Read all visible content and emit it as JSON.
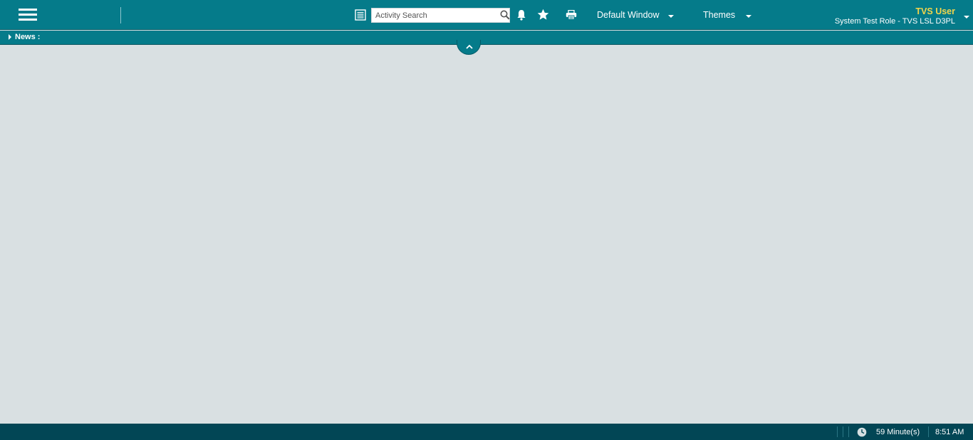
{
  "header": {
    "search_placeholder": "Activity Search",
    "default_window_label": "Default Window",
    "themes_label": "Themes",
    "user_name": "TVS User",
    "user_role": "System Test Role - TVS LSL D3PL",
    "icons": [
      "menu-icon",
      "list-icon",
      "search-icon",
      "bell-icon",
      "star-icon",
      "printer-icon"
    ]
  },
  "news": {
    "label": "News :"
  },
  "footer": {
    "session_time": "59 Minute(s)",
    "clock_time": "8:51 AM"
  },
  "colors": {
    "header_bg": "#057b8a",
    "footer_bg": "#024655",
    "content_bg": "#d9e0e2",
    "user_name": "#f2d54b"
  }
}
